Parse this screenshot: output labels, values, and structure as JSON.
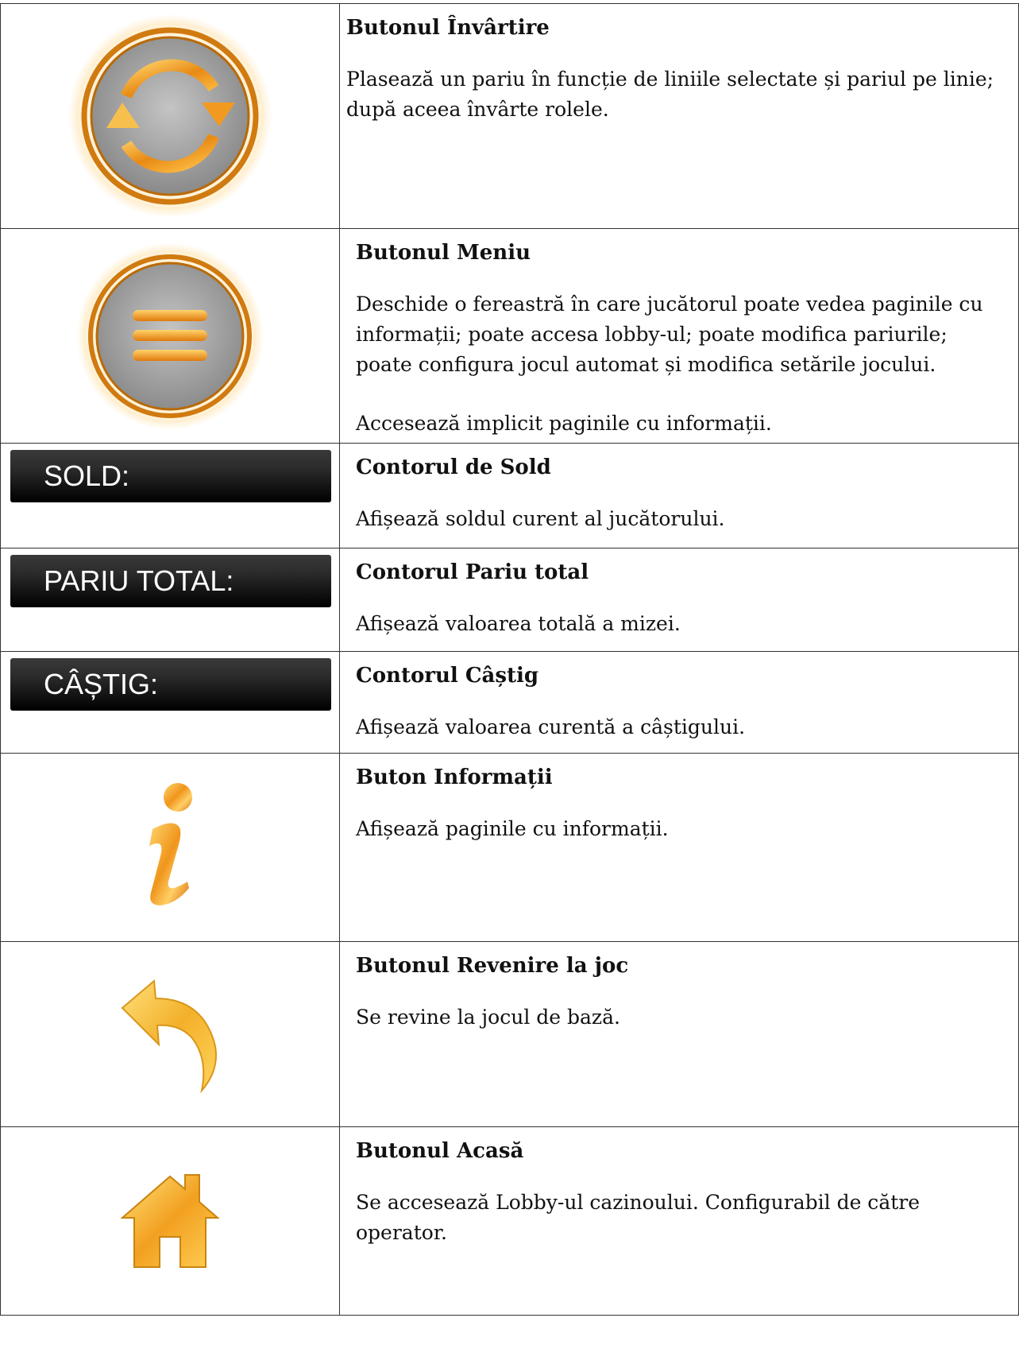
{
  "rows": [
    {
      "icon": "spin-icon",
      "title": "Butonul Învârtire",
      "desc": [
        "Plasează un pariu în funcție de liniile selectate și pariul pe linie; după aceea învârte rolele."
      ]
    },
    {
      "icon": "menu-icon",
      "title": "Butonul Meniu",
      "desc": [
        "Deschide o fereastră în care jucătorul poate vedea paginile cu informații; poate accesa lobby-ul; poate modifica pariurile; poate configura jocul automat și modifica setările jocului.",
        "Accesează implicit paginile cu informații."
      ]
    },
    {
      "counter_label": "SOLD:",
      "title": "Contorul de Sold",
      "desc": [
        "Afișează soldul curent al jucătorului."
      ]
    },
    {
      "counter_label": "PARIU TOTAL:",
      "title": "Contorul Pariu total",
      "desc": [
        "Afișează valoarea totală a mizei."
      ]
    },
    {
      "counter_label": "CÂȘTIG:",
      "title": "Contorul Câștig",
      "desc": [
        "Afișează valoarea curentă a câștigului."
      ]
    },
    {
      "icon": "info-icon",
      "title": "Buton Informații",
      "desc": [
        "Afișează paginile cu informații."
      ]
    },
    {
      "icon": "return-icon",
      "title": "Butonul Revenire la joc",
      "desc": [
        "Se revine la jocul de bază."
      ]
    },
    {
      "icon": "home-icon",
      "title": "Butonul Acasă",
      "desc": [
        "Se accesează Lobby-ul cazinoului. Configurabil de către operator."
      ]
    }
  ]
}
